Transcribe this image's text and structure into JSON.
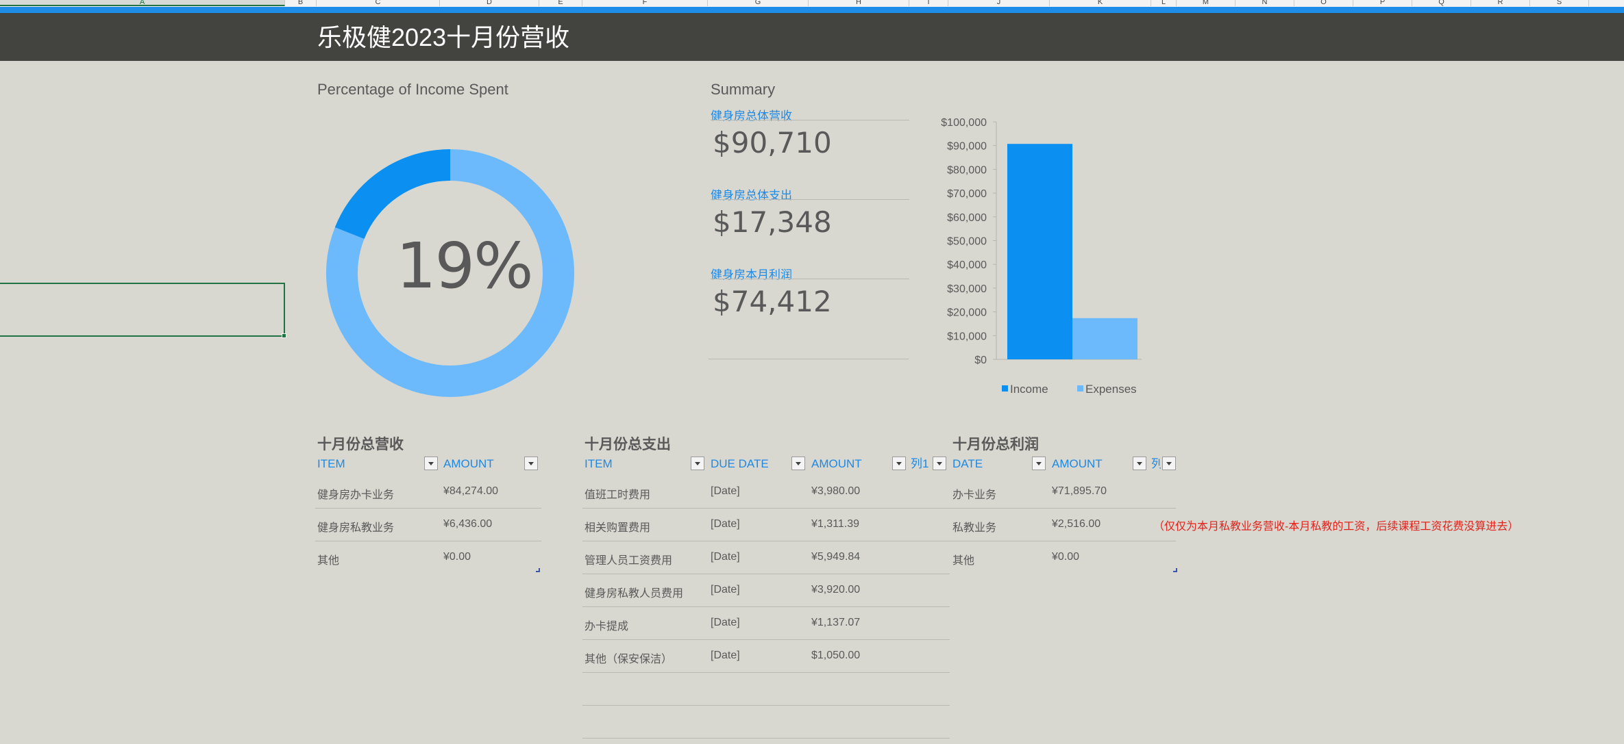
{
  "columns": [
    "A",
    "B",
    "C",
    "D",
    "E",
    "F",
    "G",
    "H",
    "I",
    "J",
    "K",
    "L",
    "M",
    "N",
    "O",
    "P",
    "Q",
    "R",
    "S"
  ],
  "title": "乐极健2023十月份营收",
  "donut": {
    "title": "Percentage of Income Spent",
    "percent_label": "19%",
    "spent_fraction": 0.19,
    "colors": {
      "spent": "#0b8ff0",
      "remaining": "#6cbafc"
    }
  },
  "summary": {
    "title": "Summary",
    "items": [
      {
        "label": "健身房总体营收",
        "value": "$90,710"
      },
      {
        "label": "健身房总体支出",
        "value": "$17,348"
      },
      {
        "label": "健身房本月利润",
        "value": "$74,412"
      }
    ]
  },
  "chart_data": {
    "type": "bar",
    "categories": [
      "Income",
      "Expenses"
    ],
    "values": [
      90710,
      17348
    ],
    "colors": [
      "#0b8ff0",
      "#6cbafc"
    ],
    "yticks": [
      "$0",
      "$10,000",
      "$20,000",
      "$30,000",
      "$40,000",
      "$50,000",
      "$60,000",
      "$70,000",
      "$80,000",
      "$90,000",
      "$100,000"
    ],
    "ylim": [
      0,
      100000
    ],
    "legend": [
      "Income",
      "Expenses"
    ],
    "legend_position": "bottom"
  },
  "revenue": {
    "title": "十月份总营收",
    "headers": [
      "ITEM",
      "AMOUNT"
    ],
    "rows": [
      [
        "健身房办卡业务",
        "¥84,274.00"
      ],
      [
        "健身房私教业务",
        "¥6,436.00"
      ],
      [
        "其他",
        "¥0.00"
      ]
    ]
  },
  "expenses": {
    "title": "十月份总支出",
    "headers": [
      "ITEM",
      "DUE DATE",
      "AMOUNT",
      "列1"
    ],
    "rows": [
      [
        "值班工时费用",
        "[Date]",
        "¥3,980.00"
      ],
      [
        "相关购置费用",
        "[Date]",
        "¥1,311.39"
      ],
      [
        "管理人员工资费用",
        "[Date]",
        "¥5,949.84"
      ],
      [
        "健身房私教人员费用",
        "[Date]",
        "¥3,920.00"
      ],
      [
        "办卡提成",
        "[Date]",
        "¥1,137.07"
      ],
      [
        "其他（保安保洁）",
        "[Date]",
        "$1,050.00"
      ]
    ]
  },
  "profit": {
    "title": "十月份总利润",
    "headers": [
      "DATE",
      "AMOUNT",
      "列"
    ],
    "rows": [
      [
        "办卡业务",
        "¥71,895.70"
      ],
      [
        "私教业务",
        "¥2,516.00"
      ],
      [
        "其他",
        "¥0.00"
      ]
    ],
    "note": "（仅仅为本月私教业务营收-本月私教的工资，后续课程工资花费没算进去）"
  }
}
